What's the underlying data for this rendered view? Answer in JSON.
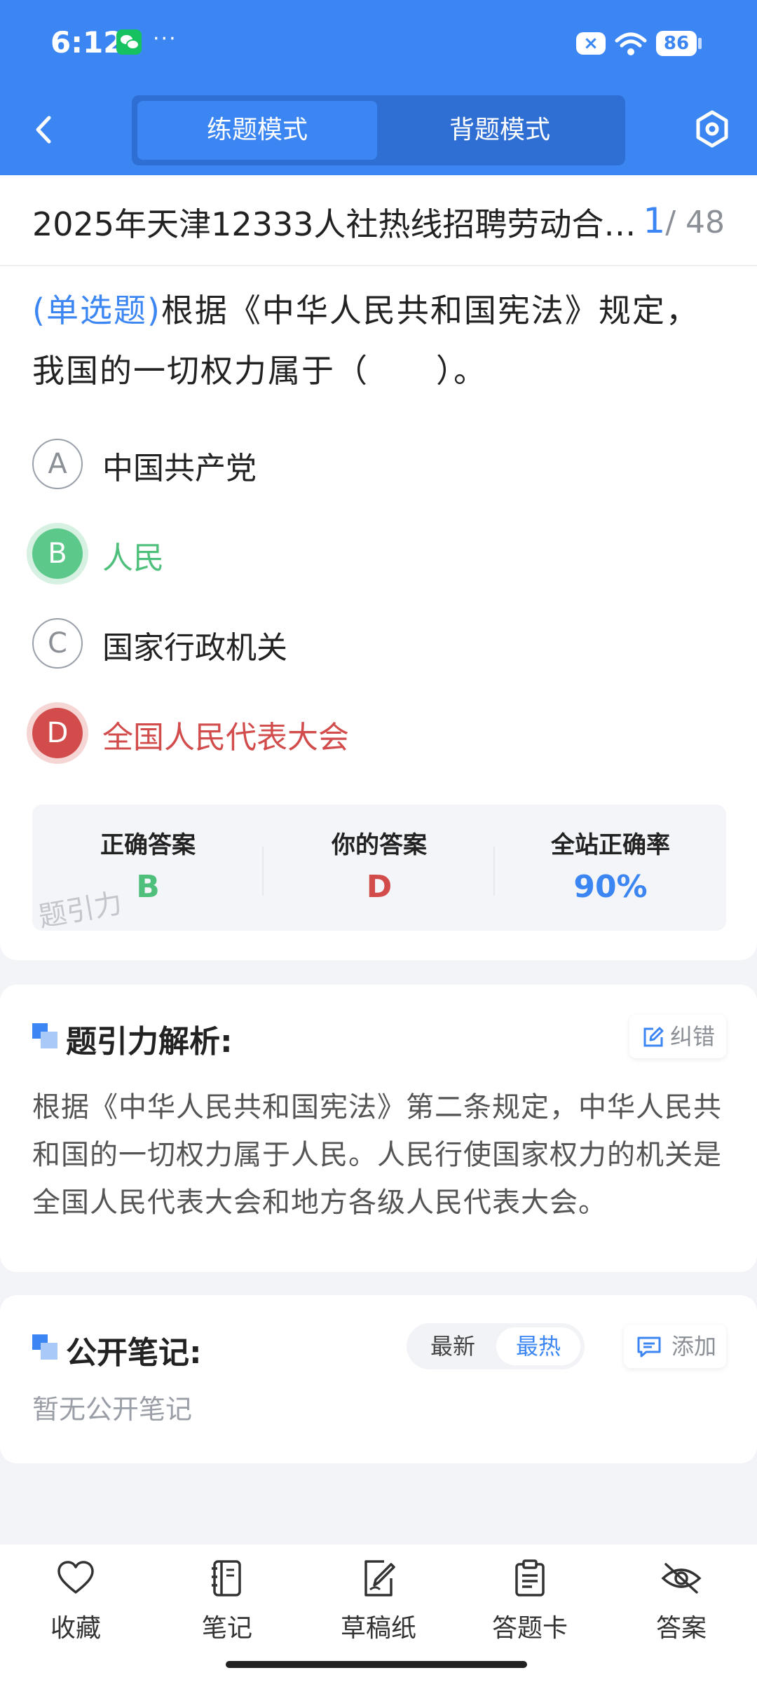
{
  "status_bar": {
    "time": "6:12",
    "more": "···",
    "mute_badge": "×",
    "battery": "86"
  },
  "header": {
    "tabs": [
      {
        "label": "练题模式",
        "active": true
      },
      {
        "label": "背题模式",
        "active": false
      }
    ],
    "accent_color": "#3b86f2"
  },
  "exam": {
    "title": "2025年天津12333人社热线招聘劳动合同制...",
    "current": "1",
    "total": "/ 48"
  },
  "question": {
    "type_label": "(单选题)",
    "text": "根据《中华人民共和国宪法》规定，我国的一切权力属于（　　）。",
    "options": [
      {
        "letter": "A",
        "text": "中国共产党",
        "state": "normal"
      },
      {
        "letter": "B",
        "text": "人民",
        "state": "correct"
      },
      {
        "letter": "C",
        "text": "国家行政机关",
        "state": "normal"
      },
      {
        "letter": "D",
        "text": "全国人民代表大会",
        "state": "wrong"
      }
    ]
  },
  "answer_summary": {
    "correct_label": "正确答案",
    "correct_value": "B",
    "yours_label": "你的答案",
    "yours_value": "D",
    "rate_label": "全站正确率",
    "rate_value": "90%",
    "watermark": "题引力",
    "colors": {
      "correct": "#4fbf7c",
      "wrong": "#d24c4c",
      "rate": "#3b86f2"
    }
  },
  "analysis": {
    "title": "题引力解析:",
    "report_label": "纠错",
    "text": "根据《中华人民共和国宪法》第二条规定，中华人民共和国的一切权力属于人民。人民行使国家权力的机关是全国人民代表大会和地方各级人民代表大会。"
  },
  "notes": {
    "title": "公开笔记:",
    "sort_options": [
      "最新",
      "最热"
    ],
    "sort_selected": "最热",
    "add_label": "添加",
    "empty_text": "暂无公开笔记"
  },
  "bottom_bar": {
    "items": [
      {
        "label": "收藏",
        "icon": "heart-icon"
      },
      {
        "label": "笔记",
        "icon": "notebook-icon"
      },
      {
        "label": "草稿纸",
        "icon": "draft-paper-icon"
      },
      {
        "label": "答题卡",
        "icon": "answer-sheet-icon"
      },
      {
        "label": "答案",
        "icon": "eye-off-icon"
      }
    ]
  }
}
